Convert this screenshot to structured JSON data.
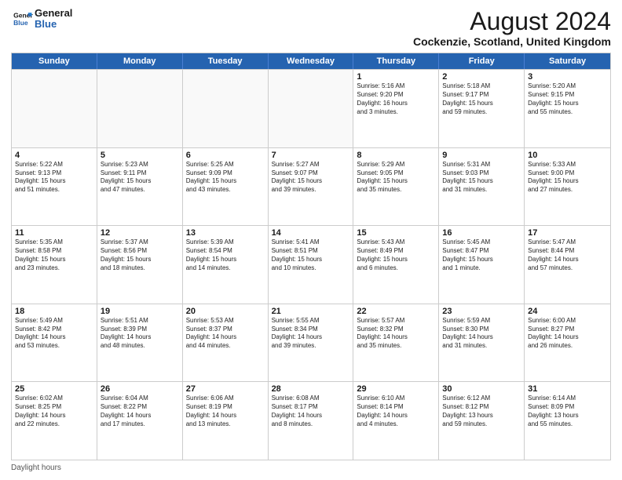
{
  "logo": {
    "line1": "General",
    "line2": "Blue"
  },
  "title": "August 2024",
  "subtitle": "Cockenzie, Scotland, United Kingdom",
  "days_of_week": [
    "Sunday",
    "Monday",
    "Tuesday",
    "Wednesday",
    "Thursday",
    "Friday",
    "Saturday"
  ],
  "footer_label": "Daylight hours",
  "weeks": [
    [
      {
        "day": "",
        "empty": true
      },
      {
        "day": "",
        "empty": true
      },
      {
        "day": "",
        "empty": true
      },
      {
        "day": "",
        "empty": true
      },
      {
        "day": "1",
        "info": "Sunrise: 5:16 AM\nSunset: 9:20 PM\nDaylight: 16 hours\nand 3 minutes."
      },
      {
        "day": "2",
        "info": "Sunrise: 5:18 AM\nSunset: 9:17 PM\nDaylight: 15 hours\nand 59 minutes."
      },
      {
        "day": "3",
        "info": "Sunrise: 5:20 AM\nSunset: 9:15 PM\nDaylight: 15 hours\nand 55 minutes."
      }
    ],
    [
      {
        "day": "4",
        "info": "Sunrise: 5:22 AM\nSunset: 9:13 PM\nDaylight: 15 hours\nand 51 minutes."
      },
      {
        "day": "5",
        "info": "Sunrise: 5:23 AM\nSunset: 9:11 PM\nDaylight: 15 hours\nand 47 minutes."
      },
      {
        "day": "6",
        "info": "Sunrise: 5:25 AM\nSunset: 9:09 PM\nDaylight: 15 hours\nand 43 minutes."
      },
      {
        "day": "7",
        "info": "Sunrise: 5:27 AM\nSunset: 9:07 PM\nDaylight: 15 hours\nand 39 minutes."
      },
      {
        "day": "8",
        "info": "Sunrise: 5:29 AM\nSunset: 9:05 PM\nDaylight: 15 hours\nand 35 minutes."
      },
      {
        "day": "9",
        "info": "Sunrise: 5:31 AM\nSunset: 9:03 PM\nDaylight: 15 hours\nand 31 minutes."
      },
      {
        "day": "10",
        "info": "Sunrise: 5:33 AM\nSunset: 9:00 PM\nDaylight: 15 hours\nand 27 minutes."
      }
    ],
    [
      {
        "day": "11",
        "info": "Sunrise: 5:35 AM\nSunset: 8:58 PM\nDaylight: 15 hours\nand 23 minutes."
      },
      {
        "day": "12",
        "info": "Sunrise: 5:37 AM\nSunset: 8:56 PM\nDaylight: 15 hours\nand 18 minutes."
      },
      {
        "day": "13",
        "info": "Sunrise: 5:39 AM\nSunset: 8:54 PM\nDaylight: 15 hours\nand 14 minutes."
      },
      {
        "day": "14",
        "info": "Sunrise: 5:41 AM\nSunset: 8:51 PM\nDaylight: 15 hours\nand 10 minutes."
      },
      {
        "day": "15",
        "info": "Sunrise: 5:43 AM\nSunset: 8:49 PM\nDaylight: 15 hours\nand 6 minutes."
      },
      {
        "day": "16",
        "info": "Sunrise: 5:45 AM\nSunset: 8:47 PM\nDaylight: 15 hours\nand 1 minute."
      },
      {
        "day": "17",
        "info": "Sunrise: 5:47 AM\nSunset: 8:44 PM\nDaylight: 14 hours\nand 57 minutes."
      }
    ],
    [
      {
        "day": "18",
        "info": "Sunrise: 5:49 AM\nSunset: 8:42 PM\nDaylight: 14 hours\nand 53 minutes."
      },
      {
        "day": "19",
        "info": "Sunrise: 5:51 AM\nSunset: 8:39 PM\nDaylight: 14 hours\nand 48 minutes."
      },
      {
        "day": "20",
        "info": "Sunrise: 5:53 AM\nSunset: 8:37 PM\nDaylight: 14 hours\nand 44 minutes."
      },
      {
        "day": "21",
        "info": "Sunrise: 5:55 AM\nSunset: 8:34 PM\nDaylight: 14 hours\nand 39 minutes."
      },
      {
        "day": "22",
        "info": "Sunrise: 5:57 AM\nSunset: 8:32 PM\nDaylight: 14 hours\nand 35 minutes."
      },
      {
        "day": "23",
        "info": "Sunrise: 5:59 AM\nSunset: 8:30 PM\nDaylight: 14 hours\nand 31 minutes."
      },
      {
        "day": "24",
        "info": "Sunrise: 6:00 AM\nSunset: 8:27 PM\nDaylight: 14 hours\nand 26 minutes."
      }
    ],
    [
      {
        "day": "25",
        "info": "Sunrise: 6:02 AM\nSunset: 8:25 PM\nDaylight: 14 hours\nand 22 minutes."
      },
      {
        "day": "26",
        "info": "Sunrise: 6:04 AM\nSunset: 8:22 PM\nDaylight: 14 hours\nand 17 minutes."
      },
      {
        "day": "27",
        "info": "Sunrise: 6:06 AM\nSunset: 8:19 PM\nDaylight: 14 hours\nand 13 minutes."
      },
      {
        "day": "28",
        "info": "Sunrise: 6:08 AM\nSunset: 8:17 PM\nDaylight: 14 hours\nand 8 minutes."
      },
      {
        "day": "29",
        "info": "Sunrise: 6:10 AM\nSunset: 8:14 PM\nDaylight: 14 hours\nand 4 minutes."
      },
      {
        "day": "30",
        "info": "Sunrise: 6:12 AM\nSunset: 8:12 PM\nDaylight: 13 hours\nand 59 minutes."
      },
      {
        "day": "31",
        "info": "Sunrise: 6:14 AM\nSunset: 8:09 PM\nDaylight: 13 hours\nand 55 minutes."
      }
    ]
  ]
}
